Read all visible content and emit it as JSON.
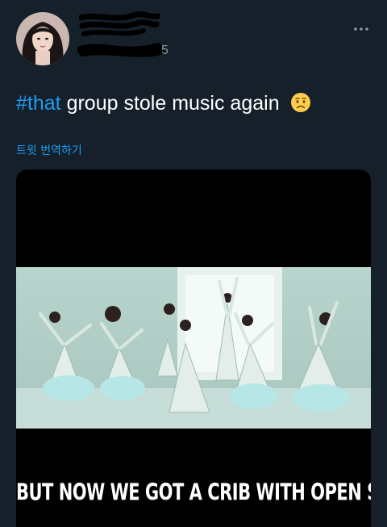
{
  "tweet": {
    "hashtag": "#that",
    "text": "group stole music again",
    "emoji_icon": "worried-face-icon",
    "translate_label": "트윗 번역하기"
  },
  "media": {
    "caption": "BUT NOW WE GOT A CRIB WITH OPEN SPACES"
  },
  "colors": {
    "background": "#15202b",
    "link": "#1d9bf0"
  }
}
